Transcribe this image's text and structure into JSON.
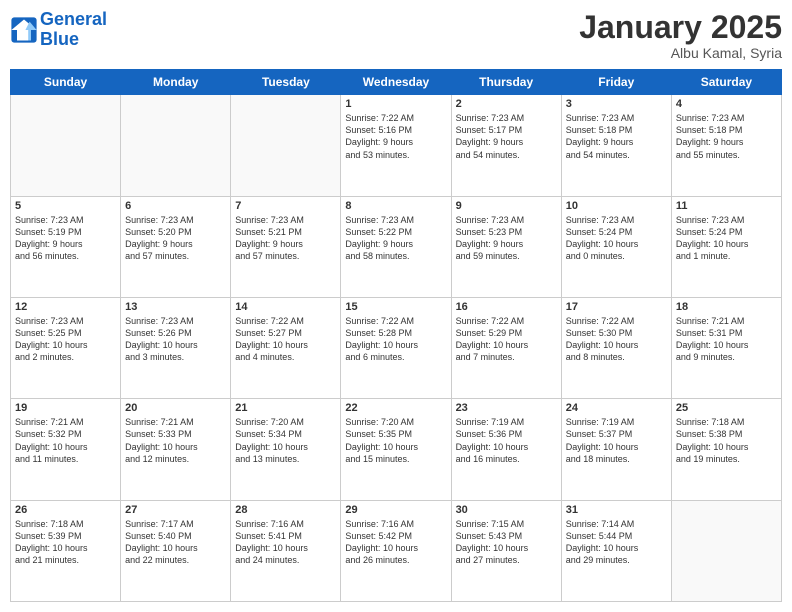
{
  "header": {
    "logo_line1": "General",
    "logo_line2": "Blue",
    "month": "January 2025",
    "location": "Albu Kamal, Syria"
  },
  "weekdays": [
    "Sunday",
    "Monday",
    "Tuesday",
    "Wednesday",
    "Thursday",
    "Friday",
    "Saturday"
  ],
  "weeks": [
    [
      {
        "day": "",
        "text": ""
      },
      {
        "day": "",
        "text": ""
      },
      {
        "day": "",
        "text": ""
      },
      {
        "day": "1",
        "text": "Sunrise: 7:22 AM\nSunset: 5:16 PM\nDaylight: 9 hours\nand 53 minutes."
      },
      {
        "day": "2",
        "text": "Sunrise: 7:23 AM\nSunset: 5:17 PM\nDaylight: 9 hours\nand 54 minutes."
      },
      {
        "day": "3",
        "text": "Sunrise: 7:23 AM\nSunset: 5:18 PM\nDaylight: 9 hours\nand 54 minutes."
      },
      {
        "day": "4",
        "text": "Sunrise: 7:23 AM\nSunset: 5:18 PM\nDaylight: 9 hours\nand 55 minutes."
      }
    ],
    [
      {
        "day": "5",
        "text": "Sunrise: 7:23 AM\nSunset: 5:19 PM\nDaylight: 9 hours\nand 56 minutes."
      },
      {
        "day": "6",
        "text": "Sunrise: 7:23 AM\nSunset: 5:20 PM\nDaylight: 9 hours\nand 57 minutes."
      },
      {
        "day": "7",
        "text": "Sunrise: 7:23 AM\nSunset: 5:21 PM\nDaylight: 9 hours\nand 57 minutes."
      },
      {
        "day": "8",
        "text": "Sunrise: 7:23 AM\nSunset: 5:22 PM\nDaylight: 9 hours\nand 58 minutes."
      },
      {
        "day": "9",
        "text": "Sunrise: 7:23 AM\nSunset: 5:23 PM\nDaylight: 9 hours\nand 59 minutes."
      },
      {
        "day": "10",
        "text": "Sunrise: 7:23 AM\nSunset: 5:24 PM\nDaylight: 10 hours\nand 0 minutes."
      },
      {
        "day": "11",
        "text": "Sunrise: 7:23 AM\nSunset: 5:24 PM\nDaylight: 10 hours\nand 1 minute."
      }
    ],
    [
      {
        "day": "12",
        "text": "Sunrise: 7:23 AM\nSunset: 5:25 PM\nDaylight: 10 hours\nand 2 minutes."
      },
      {
        "day": "13",
        "text": "Sunrise: 7:23 AM\nSunset: 5:26 PM\nDaylight: 10 hours\nand 3 minutes."
      },
      {
        "day": "14",
        "text": "Sunrise: 7:22 AM\nSunset: 5:27 PM\nDaylight: 10 hours\nand 4 minutes."
      },
      {
        "day": "15",
        "text": "Sunrise: 7:22 AM\nSunset: 5:28 PM\nDaylight: 10 hours\nand 6 minutes."
      },
      {
        "day": "16",
        "text": "Sunrise: 7:22 AM\nSunset: 5:29 PM\nDaylight: 10 hours\nand 7 minutes."
      },
      {
        "day": "17",
        "text": "Sunrise: 7:22 AM\nSunset: 5:30 PM\nDaylight: 10 hours\nand 8 minutes."
      },
      {
        "day": "18",
        "text": "Sunrise: 7:21 AM\nSunset: 5:31 PM\nDaylight: 10 hours\nand 9 minutes."
      }
    ],
    [
      {
        "day": "19",
        "text": "Sunrise: 7:21 AM\nSunset: 5:32 PM\nDaylight: 10 hours\nand 11 minutes."
      },
      {
        "day": "20",
        "text": "Sunrise: 7:21 AM\nSunset: 5:33 PM\nDaylight: 10 hours\nand 12 minutes."
      },
      {
        "day": "21",
        "text": "Sunrise: 7:20 AM\nSunset: 5:34 PM\nDaylight: 10 hours\nand 13 minutes."
      },
      {
        "day": "22",
        "text": "Sunrise: 7:20 AM\nSunset: 5:35 PM\nDaylight: 10 hours\nand 15 minutes."
      },
      {
        "day": "23",
        "text": "Sunrise: 7:19 AM\nSunset: 5:36 PM\nDaylight: 10 hours\nand 16 minutes."
      },
      {
        "day": "24",
        "text": "Sunrise: 7:19 AM\nSunset: 5:37 PM\nDaylight: 10 hours\nand 18 minutes."
      },
      {
        "day": "25",
        "text": "Sunrise: 7:18 AM\nSunset: 5:38 PM\nDaylight: 10 hours\nand 19 minutes."
      }
    ],
    [
      {
        "day": "26",
        "text": "Sunrise: 7:18 AM\nSunset: 5:39 PM\nDaylight: 10 hours\nand 21 minutes."
      },
      {
        "day": "27",
        "text": "Sunrise: 7:17 AM\nSunset: 5:40 PM\nDaylight: 10 hours\nand 22 minutes."
      },
      {
        "day": "28",
        "text": "Sunrise: 7:16 AM\nSunset: 5:41 PM\nDaylight: 10 hours\nand 24 minutes."
      },
      {
        "day": "29",
        "text": "Sunrise: 7:16 AM\nSunset: 5:42 PM\nDaylight: 10 hours\nand 26 minutes."
      },
      {
        "day": "30",
        "text": "Sunrise: 7:15 AM\nSunset: 5:43 PM\nDaylight: 10 hours\nand 27 minutes."
      },
      {
        "day": "31",
        "text": "Sunrise: 7:14 AM\nSunset: 5:44 PM\nDaylight: 10 hours\nand 29 minutes."
      },
      {
        "day": "",
        "text": ""
      }
    ]
  ]
}
